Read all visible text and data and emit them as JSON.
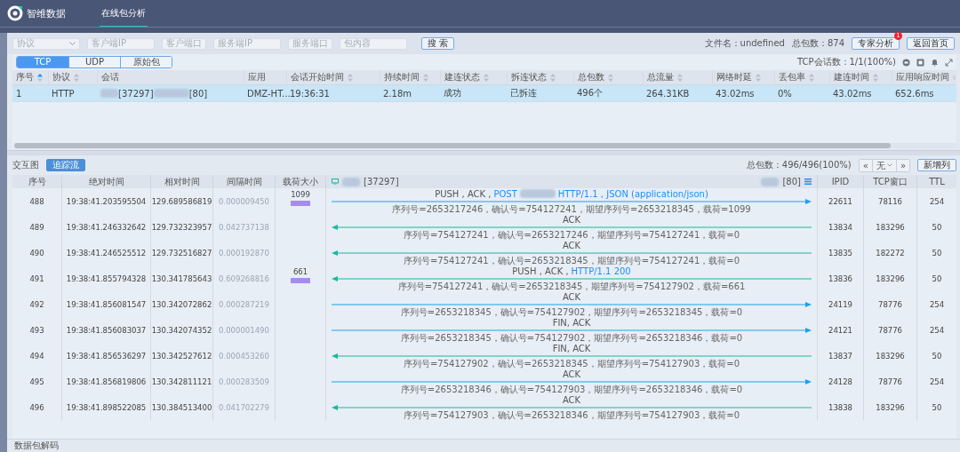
{
  "app": {
    "logo_text": "智维数据",
    "nav": [
      {
        "label": "在线包分析",
        "selected": true
      }
    ]
  },
  "filters": [
    {
      "kind": "select",
      "placeholder": "协议"
    },
    {
      "kind": "input",
      "placeholder": "客户端IP"
    },
    {
      "kind": "input",
      "placeholder": "客户端口"
    },
    {
      "kind": "input",
      "placeholder": "服务端IP"
    },
    {
      "kind": "input",
      "placeholder": "服务端口"
    },
    {
      "kind": "input",
      "placeholder": "包内容"
    }
  ],
  "search_button": "搜 索",
  "file_info": "文件名：undefined",
  "total_info": "总包数：874",
  "expert_button": {
    "label": "专家分析",
    "badge": "1"
  },
  "home_button": "返回首页",
  "tabs": [
    {
      "label": "TCP",
      "selected": true
    },
    {
      "label": "UDP",
      "selected": false
    },
    {
      "label": "原始包",
      "selected": false
    }
  ],
  "session_count": "TCP会话数：1/1(100%)",
  "sessions": {
    "columns": [
      {
        "label": "序号",
        "sortable": true,
        "sorted": true
      },
      {
        "label": "协议",
        "sortable": true,
        "sorted": false
      },
      {
        "label": "会话",
        "sortable": false
      },
      {
        "label": "应用",
        "sortable": false
      },
      {
        "label": "会话开始时间",
        "sortable": true,
        "sorted": false
      },
      {
        "label": "持续时间",
        "sortable": true,
        "sorted": false
      },
      {
        "label": "建连状态",
        "sortable": true,
        "sorted": false
      },
      {
        "label": "拆连状态",
        "sortable": true,
        "sorted": false
      },
      {
        "label": "总包数",
        "sortable": true,
        "sorted": false
      },
      {
        "label": "总流量",
        "sortable": true,
        "sorted": false
      },
      {
        "label": "网络时延",
        "sortable": true,
        "sorted": false
      },
      {
        "label": "丢包率",
        "sortable": true,
        "sorted": false
      },
      {
        "label": "建连时间",
        "sortable": true,
        "sorted": false
      },
      {
        "label": "应用响应时间",
        "sortable": true,
        "sorted": false
      }
    ],
    "rows": [
      {
        "selected": true,
        "cells": [
          "1",
          "HTTP",
          [
            "[37297]",
            "[80]"
          ],
          "DMZ-HT...",
          "19:36:31",
          "2.18m",
          "成功",
          "已拆连",
          "496个",
          "264.31KB",
          "43.02ms",
          "0%",
          "43.02ms",
          "652.6ms"
        ]
      }
    ]
  },
  "flow": {
    "label": "交互图",
    "follow_button": "追踪流",
    "total": "总包数：496/496(100%)",
    "pager": {
      "prev": "«",
      "value": "无",
      "next": "»"
    },
    "add_column_button": "新增列",
    "columns": [
      "序号",
      "绝对时间",
      "相对时间",
      "间隔时间",
      "载荷大小",
      "IPID",
      "TCP窗口",
      "TTL"
    ],
    "client": "[37297]",
    "server": "[80]",
    "packets": [
      {
        "no": "488",
        "abs": "19:38:41.203595504",
        "rel": "129.689586819",
        "gap": "0.000009450",
        "payload": "1099",
        "to_server": true,
        "flags": "PUSH , ACK ,",
        "info": [
          "POST",
          "HTTP/1.1 , JSON (application/json)"
        ],
        "detail": "序列号=2653217246，确认号=754127241，期望序列号=2653218345，载荷=1099",
        "ipid": "22611",
        "window": "78116",
        "ttl": "254"
      },
      {
        "no": "489",
        "abs": "19:38:41.246332642",
        "rel": "129.732323957",
        "gap": "0.042737138",
        "to_server": false,
        "flags": "ACK",
        "detail": "序列号=754127241，确认号=2653217246，期望序列号=754127241，载荷=0",
        "ipid": "13834",
        "window": "183296",
        "ttl": "50"
      },
      {
        "no": "490",
        "abs": "19:38:41.246525512",
        "rel": "129.732516827",
        "gap": "0.000192870",
        "to_server": false,
        "flags": "ACK",
        "detail": "序列号=754127241，确认号=2653218345，期望序列号=754127241，载荷=0",
        "ipid": "13835",
        "window": "182272",
        "ttl": "50"
      },
      {
        "no": "491",
        "abs": "19:38:41.855794328",
        "rel": "130.341785643",
        "gap": "0.609268816",
        "payload": "661",
        "to_server": false,
        "flags": "PUSH , ACK ,",
        "info": [
          "HTTP/1.1 200"
        ],
        "detail": "序列号=754127241，确认号=2653218345，期望序列号=754127902，载荷=661",
        "ipid": "13836",
        "window": "183296",
        "ttl": "50"
      },
      {
        "no": "492",
        "abs": "19:38:41.856081547",
        "rel": "130.342072862",
        "gap": "0.000287219",
        "to_server": true,
        "flags": "ACK",
        "detail": "序列号=2653218345，确认号=754127902，期望序列号=2653218345，载荷=0",
        "ipid": "24119",
        "window": "78776",
        "ttl": "254"
      },
      {
        "no": "493",
        "abs": "19:38:41.856083037",
        "rel": "130.342074352",
        "gap": "0.000001490",
        "to_server": true,
        "flags": "FIN, ACK",
        "detail": "序列号=2653218345，确认号=754127902，期望序列号=2653218346，载荷=0",
        "ipid": "24121",
        "window": "78776",
        "ttl": "254"
      },
      {
        "no": "494",
        "abs": "19:38:41.856536297",
        "rel": "130.342527612",
        "gap": "0.000453260",
        "to_server": false,
        "flags": "FIN, ACK",
        "detail": "序列号=754127902，确认号=2653218345，期望序列号=754127903，载荷=0",
        "ipid": "13837",
        "window": "183296",
        "ttl": "50"
      },
      {
        "no": "495",
        "abs": "19:38:41.856819806",
        "rel": "130.342811121",
        "gap": "0.000283509",
        "to_server": true,
        "flags": "ACK",
        "detail": "序列号=2653218346，确认号=754127903，期望序列号=2653218346，载荷=0",
        "ipid": "24128",
        "window": "78776",
        "ttl": "254"
      },
      {
        "no": "496",
        "abs": "19:38:41.898522085",
        "rel": "130.384513400",
        "gap": "0.041702279",
        "to_server": false,
        "flags": "ACK",
        "detail": "序列号=754127903，确认号=2653218346，期望序列号=754127903，载荷=0",
        "ipid": "13838",
        "window": "183296",
        "ttl": "50"
      }
    ]
  },
  "decode_label": "数据包解码"
}
